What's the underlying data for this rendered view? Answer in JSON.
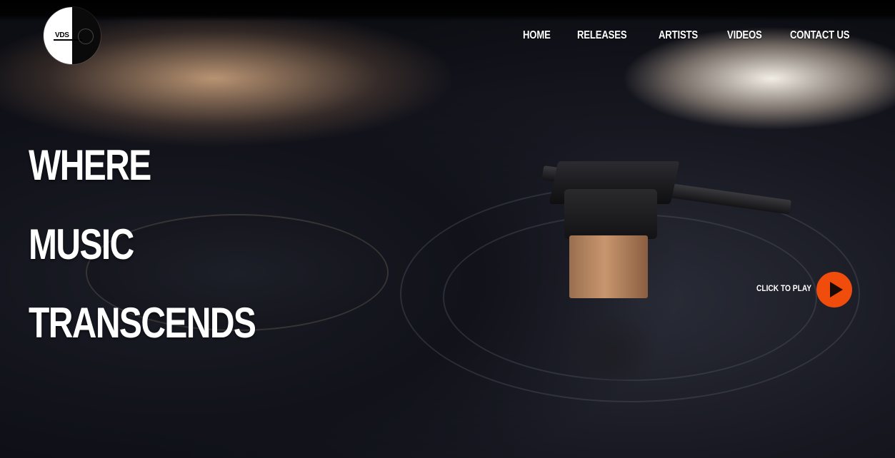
{
  "logo": {
    "text": "VDS"
  },
  "nav": {
    "items": [
      {
        "label": "HOME"
      },
      {
        "label": "RELEASES"
      },
      {
        "label": "ARTISTS"
      },
      {
        "label": "VIDEOS"
      },
      {
        "label": "CONTACT US"
      }
    ]
  },
  "hero": {
    "headline": [
      "WHERE",
      "MUSIC",
      "TRANSCENDS"
    ],
    "play_label": "CLICK TO PLAY",
    "play_icon": "play-icon"
  },
  "colors": {
    "accent": "#f04c0c",
    "text": "#ffffff",
    "background": "#0b0c12"
  }
}
